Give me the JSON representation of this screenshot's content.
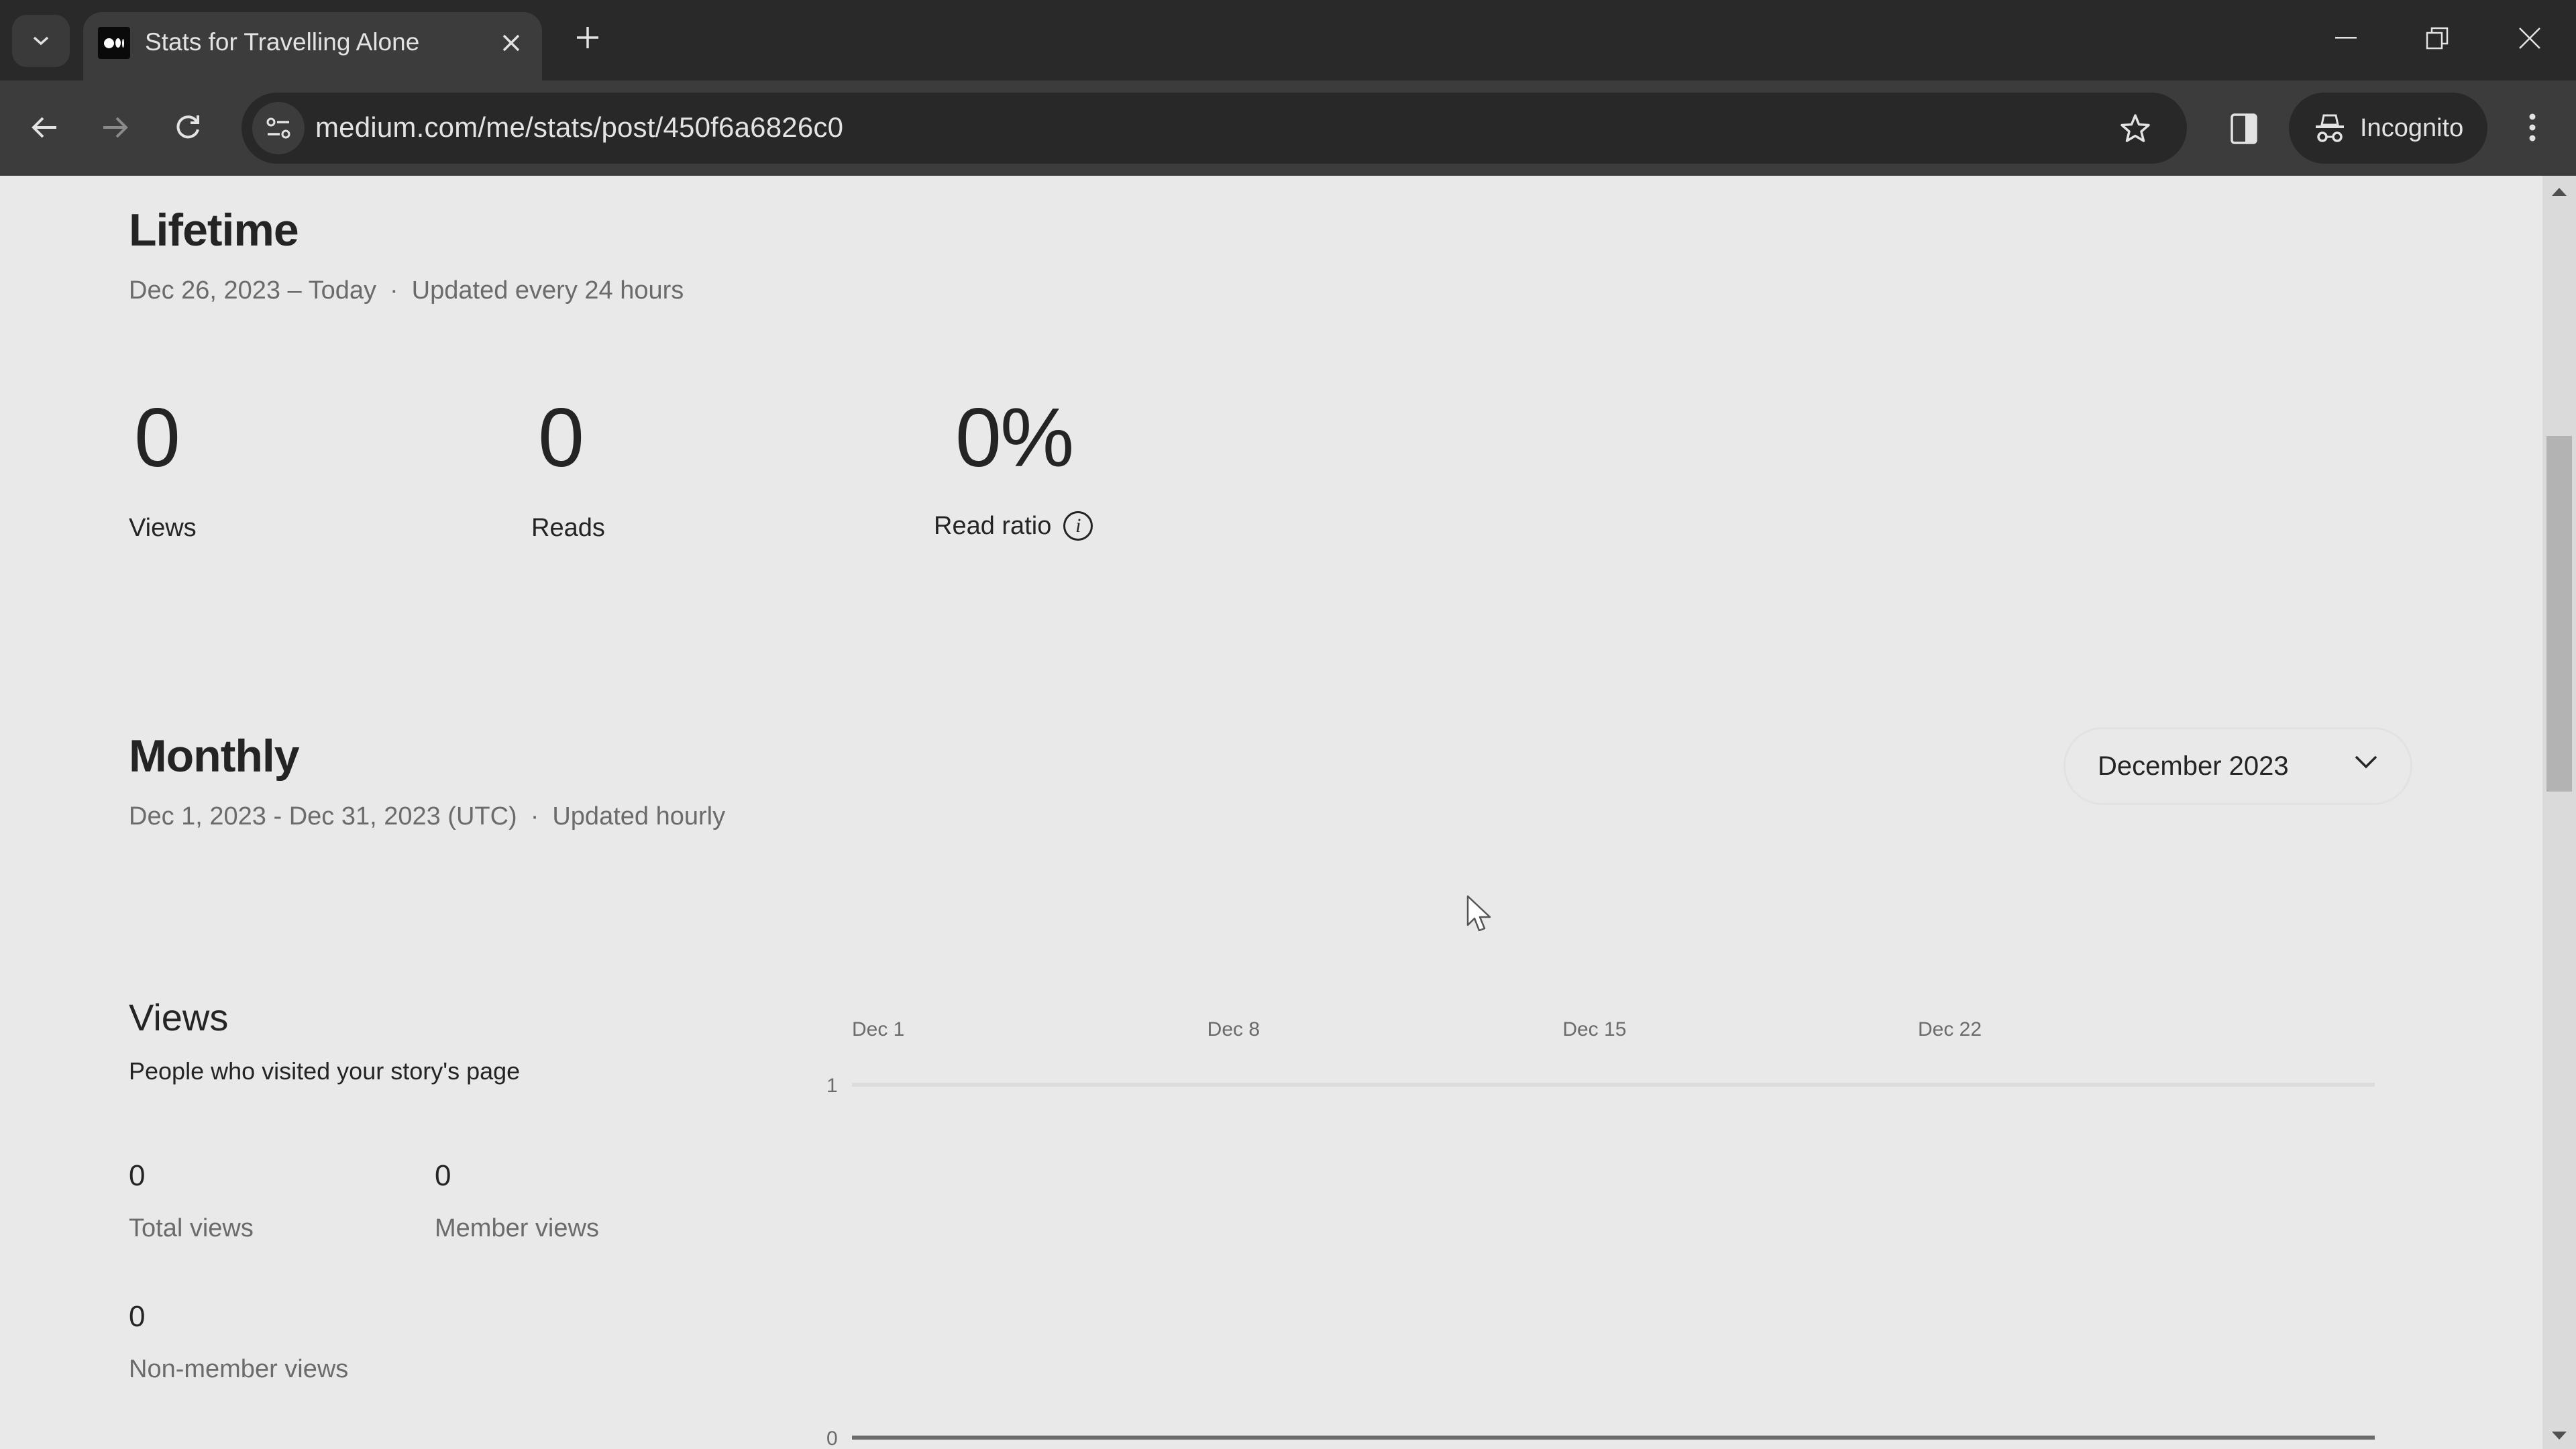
{
  "browser": {
    "tab_title": "Stats for Travelling Alone",
    "url": "medium.com/me/stats/post/450f6a6826c0",
    "incognito_label": "Incognito",
    "icons": {
      "tab_search": "chevron-down-icon",
      "favicon": "medium-logo-icon",
      "tab_close": "close-icon",
      "new_tab": "plus-icon",
      "minimize": "minimize-icon",
      "restore": "restore-icon",
      "close_window": "close-icon",
      "back": "arrow-left-icon",
      "forward": "arrow-right-icon",
      "reload": "reload-icon",
      "site_info": "tune-icon",
      "bookmark": "star-icon",
      "side_panel": "side-panel-icon",
      "incognito": "incognito-icon",
      "menu": "kebab-menu-icon"
    },
    "tab_close_glyph": "✕",
    "new_tab_glyph": "+"
  },
  "lifetime": {
    "title": "Lifetime",
    "date_range": "Dec 26, 2023 – Today",
    "separator": "·",
    "update_note": "Updated every 24 hours",
    "stats": [
      {
        "value": "0",
        "label": "Views"
      },
      {
        "value": "0",
        "label": "Reads"
      },
      {
        "value": "0%",
        "label": "Read ratio",
        "info_icon": "i"
      }
    ]
  },
  "monthly": {
    "title": "Monthly",
    "date_range": "Dec 1, 2023 - Dec 31, 2023 (UTC)",
    "separator": "·",
    "update_note": "Updated hourly",
    "month_select": {
      "selected": "December 2023"
    }
  },
  "views": {
    "title": "Views",
    "description": "People who visited your story's page",
    "stats": [
      {
        "value": "0",
        "label": "Total views"
      },
      {
        "value": "0",
        "label": "Member views"
      },
      {
        "value": "0",
        "label": "Non-member views"
      }
    ]
  },
  "chart_data": {
    "type": "line",
    "title": "Views",
    "xlabel": "",
    "ylabel": "",
    "x_ticks": [
      "Dec 1",
      "Dec 8",
      "Dec 15",
      "Dec 22"
    ],
    "y_ticks": [
      "1",
      "0"
    ],
    "ylim": [
      0,
      1
    ],
    "x": [
      "Dec 1",
      "Dec 2",
      "Dec 3",
      "Dec 4",
      "Dec 5",
      "Dec 6",
      "Dec 7",
      "Dec 8",
      "Dec 9",
      "Dec 10",
      "Dec 11",
      "Dec 12",
      "Dec 13",
      "Dec 14",
      "Dec 15",
      "Dec 16",
      "Dec 17",
      "Dec 18",
      "Dec 19",
      "Dec 20",
      "Dec 21",
      "Dec 22",
      "Dec 23",
      "Dec 24",
      "Dec 25",
      "Dec 26",
      "Dec 27",
      "Dec 28",
      "Dec 29",
      "Dec 30",
      "Dec 31"
    ],
    "series": [
      {
        "name": "Views",
        "values": [
          0,
          0,
          0,
          0,
          0,
          0,
          0,
          0,
          0,
          0,
          0,
          0,
          0,
          0,
          0,
          0,
          0,
          0,
          0,
          0,
          0,
          0,
          0,
          0,
          0,
          0,
          0,
          0,
          0,
          0,
          0
        ]
      }
    ],
    "grid": true,
    "legend": "none"
  }
}
